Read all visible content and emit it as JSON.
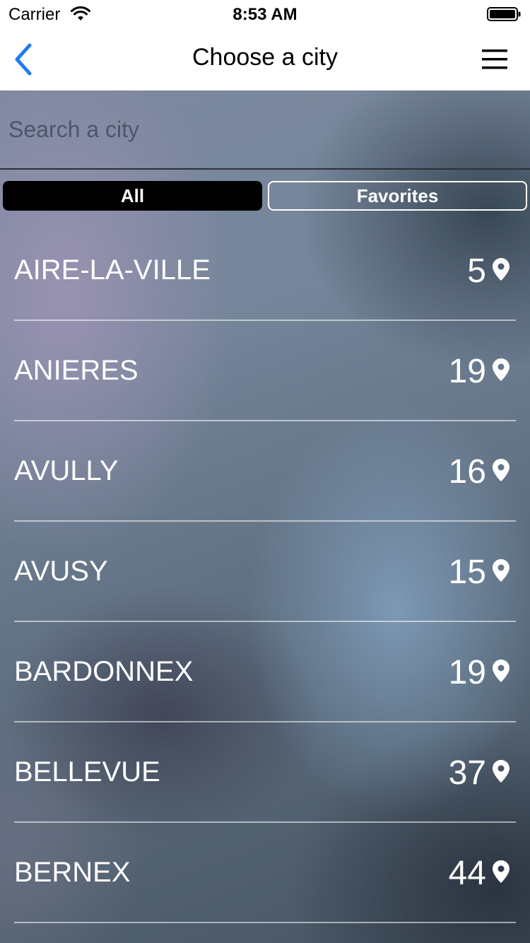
{
  "status_bar": {
    "carrier": "Carrier",
    "time": "8:53 AM"
  },
  "nav": {
    "title": "Choose a city",
    "back_icon": "chevron-left-icon",
    "menu_icon": "hamburger-menu-icon",
    "accent": "#1e7cf2"
  },
  "search": {
    "placeholder": "Search a city",
    "value": ""
  },
  "segments": {
    "all_label": "All",
    "favorites_label": "Favorites",
    "selected": "All"
  },
  "cities": [
    {
      "name": "AIRE-LA-VILLE",
      "count": "5"
    },
    {
      "name": "ANIERES",
      "count": "19"
    },
    {
      "name": "AVULLY",
      "count": "16"
    },
    {
      "name": "AVUSY",
      "count": "15"
    },
    {
      "name": "BARDONNEX",
      "count": "19"
    },
    {
      "name": "BELLEVUE",
      "count": "37"
    },
    {
      "name": "BERNEX",
      "count": "44"
    }
  ]
}
